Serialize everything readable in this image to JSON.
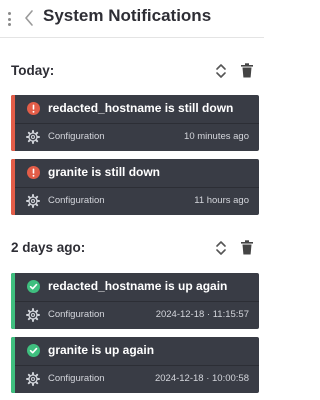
{
  "header": {
    "title": "System Notifications"
  },
  "groups": [
    {
      "label": "Today:",
      "notifications": [
        {
          "status": "down",
          "status_icon": "alert-icon",
          "message": "redacted_hostname is still down",
          "category": "Configuration",
          "time": "10 minutes ago"
        },
        {
          "status": "down",
          "status_icon": "alert-icon",
          "message": "granite is still down",
          "category": "Configuration",
          "time": "11 hours ago"
        }
      ]
    },
    {
      "label": "2 days ago:",
      "notifications": [
        {
          "status": "up",
          "status_icon": "check-icon",
          "message": "redacted_hostname is up again",
          "category": "Configuration",
          "time": "2024-12-18 · 11:15:57"
        },
        {
          "status": "up",
          "status_icon": "check-icon",
          "message": "granite is up again",
          "category": "Configuration",
          "time": "2024-12-18 · 10:00:58"
        }
      ]
    }
  ],
  "colors": {
    "down_accent": "#e35d48",
    "up_accent": "#3fbf7f",
    "card_background": "#393c45"
  }
}
